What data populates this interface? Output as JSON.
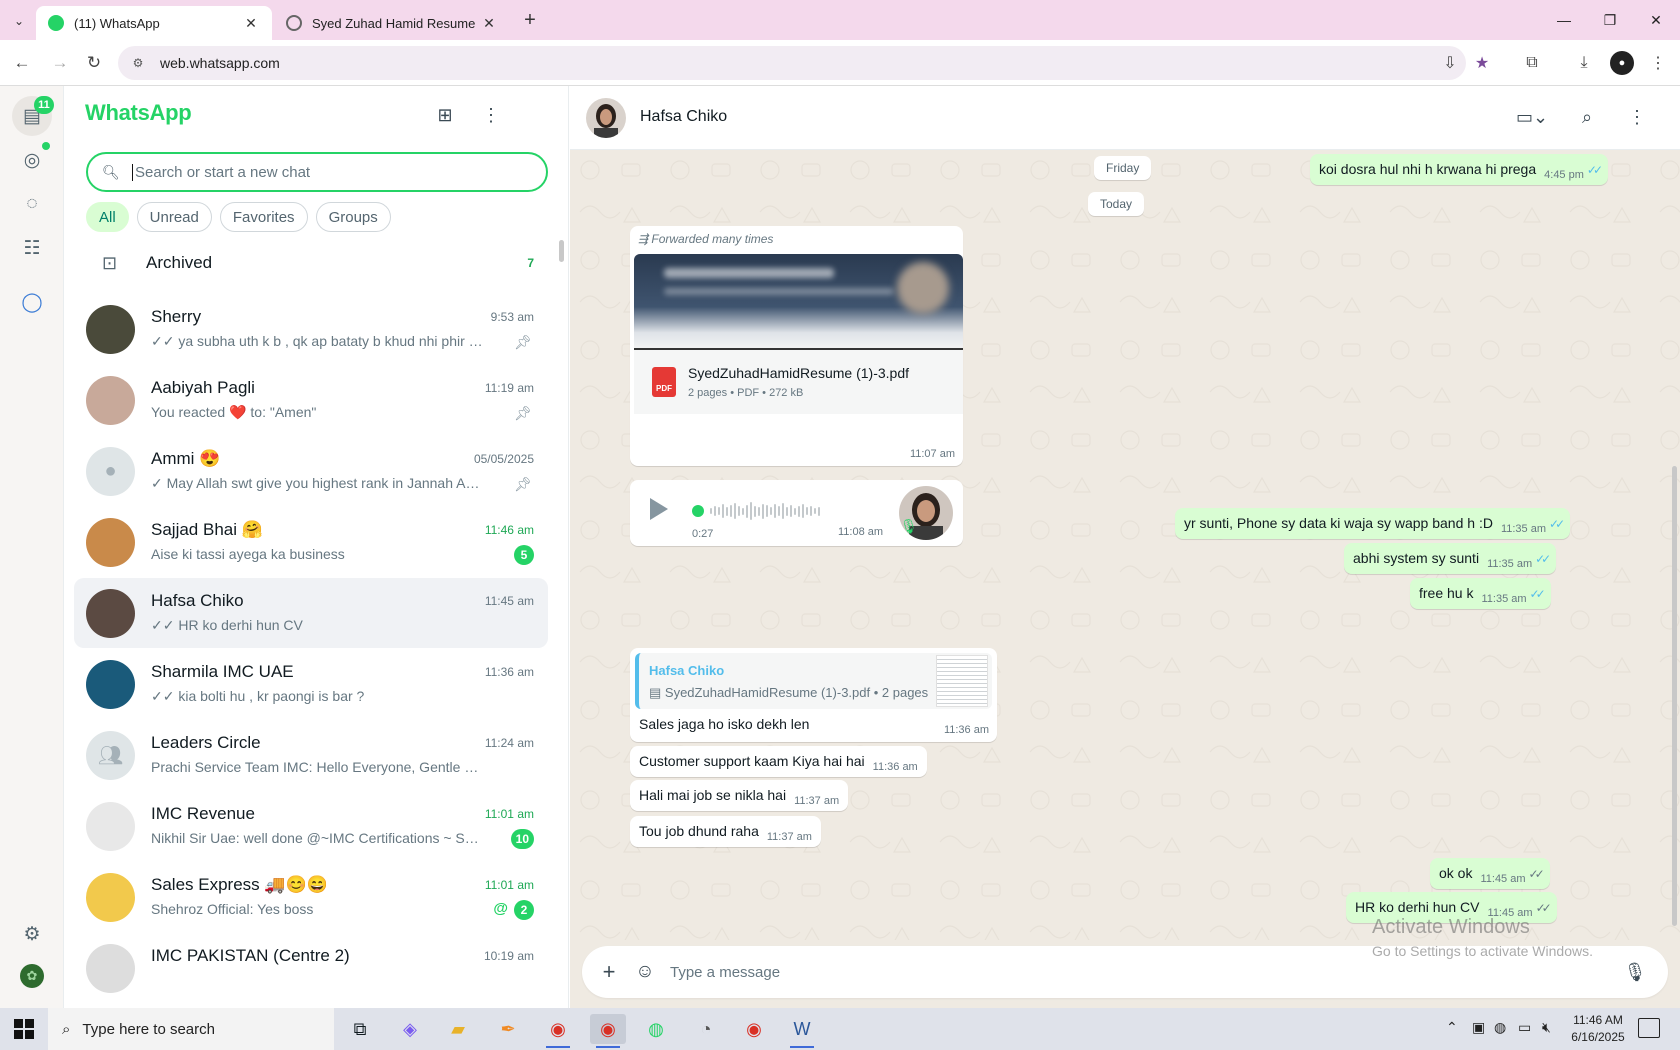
{
  "browser": {
    "tabs": [
      {
        "title": "(11) WhatsApp",
        "active": true
      },
      {
        "title": "Syed Zuhad Hamid Resume",
        "active": false
      }
    ],
    "url": "web.whatsapp.com",
    "window_controls": {
      "minimize": "—",
      "restore": "❐",
      "close": "✕"
    }
  },
  "rail": {
    "chats_badge": "11",
    "icons": [
      "chats-icon",
      "status-icon",
      "channels-icon",
      "communities-icon",
      "meta-ai-icon",
      "settings-icon",
      "profile-avatar"
    ]
  },
  "sidebar": {
    "title": "WhatsApp",
    "search_placeholder": "Search or start a new chat",
    "filters": [
      "All",
      "Unread",
      "Favorites",
      "Groups"
    ],
    "active_filter": "All",
    "archived": {
      "label": "Archived",
      "count": "7"
    },
    "chats": [
      {
        "name": "Sherry",
        "time": "9:53 am",
        "preview": "✓✓ ya subha uth k b , qk ap bataty b    khud nhi phir me...",
        "pinned": true,
        "unread": null,
        "avatar_color": "#4a4a3a"
      },
      {
        "name": "Aabiyah Pagli",
        "time": "11:19 am",
        "preview": "You reacted ❤️ to: \"Amen\"",
        "pinned": true,
        "unread": null,
        "avatar_color": "#c8a99a"
      },
      {
        "name": "Ammi 😍",
        "time": "05/05/2025",
        "preview": "✓ May Allah swt give you highest rank in Jannah  Ame...",
        "pinned": true,
        "unread": null,
        "avatar_color": "#dfe5e7"
      },
      {
        "name": "Sajjad Bhai 🤗",
        "time": "11:46 am",
        "preview": "Aise ki tassi ayega ka business",
        "pinned": false,
        "unread": "5",
        "avatar_color": "#c98a4a"
      },
      {
        "name": "Hafsa Chiko",
        "time": "11:45 am",
        "preview": "✓✓ HR ko derhi hun CV",
        "pinned": false,
        "unread": null,
        "avatar_color": "#5b4a42"
      },
      {
        "name": "Sharmila IMC UAE",
        "time": "11:36 am",
        "preview": "✓✓ kia bolti hu , kr paongi is bar ?",
        "pinned": false,
        "unread": null,
        "avatar_color": "#1a5a7a"
      },
      {
        "name": "Leaders Circle",
        "time": "11:24 am",
        "preview": "Prachi Service Team IMC: Hello Everyone, Gentle Reminder....",
        "pinned": false,
        "unread": null,
        "avatar_color": "#dfe5e7"
      },
      {
        "name": "IMC Revenue",
        "time": "11:01 am",
        "preview": "Nikhil Sir Uae: well done @~IMC Certifications ~ Suren...",
        "pinned": false,
        "unread": "10",
        "avatar_color": "#e8e8e8"
      },
      {
        "name": "Sales Express 🚚😊😄",
        "time": "11:01 am",
        "preview": "Shehroz Official: Yes boss",
        "pinned": false,
        "unread": "2",
        "mention": "@",
        "avatar_color": "#f2c94c"
      },
      {
        "name": "IMC PAKISTAN (Centre 2)",
        "time": "10:19 am",
        "preview": "",
        "pinned": false,
        "unread": null,
        "avatar_color": "#ddd"
      }
    ]
  },
  "conversation": {
    "contact": "Hafsa Chiko",
    "date_pills": [
      "Friday",
      "Today"
    ],
    "messages": {
      "out_friday": {
        "text": "koi dosra hul nhi h krwana hi prega",
        "time": "4:45 pm"
      },
      "forwarded_label": "Forwarded many times",
      "document": {
        "name": "SyedZuhadHamidResume (1)-3.pdf",
        "meta": "2 pages • PDF • 272 kB",
        "time": "11:07 am",
        "icon_label": "PDF"
      },
      "voice": {
        "duration": "0:27",
        "time": "11:08 am"
      },
      "out1": {
        "text": "yr sunti, Phone sy data ki waja sy wapp band h :D",
        "time": "11:35 am"
      },
      "out2": {
        "text": "abhi system sy sunti",
        "time": "11:35 am"
      },
      "out3": {
        "text": "free hu k",
        "time": "11:35 am"
      },
      "reply": {
        "quoted_name": "Hafsa Chiko",
        "quoted_text": "SyedZuhadHamidResume (1)-3.pdf • 2 pages",
        "text": "Sales jaga ho isko dekh len",
        "time": "11:36 am"
      },
      "in2": {
        "text": "Customer support kaam Kiya hai hai",
        "time": "11:36 am"
      },
      "in3": {
        "text": "Hali mai job se nikla hai",
        "time": "11:37 am"
      },
      "in4": {
        "text": "Tou job dhund raha",
        "time": "11:37 am"
      },
      "out4": {
        "text": "ok ok",
        "time": "11:45 am"
      },
      "out5": {
        "text": "HR ko derhi hun CV",
        "time": "11:45 am"
      }
    },
    "composer_placeholder": "Type a message",
    "watermark": {
      "line1": "Activate Windows",
      "line2": "Go to Settings to activate Windows."
    }
  },
  "taskbar": {
    "search_placeholder": "Type here to search",
    "time": "11:46 AM",
    "date": "6/16/2025"
  }
}
